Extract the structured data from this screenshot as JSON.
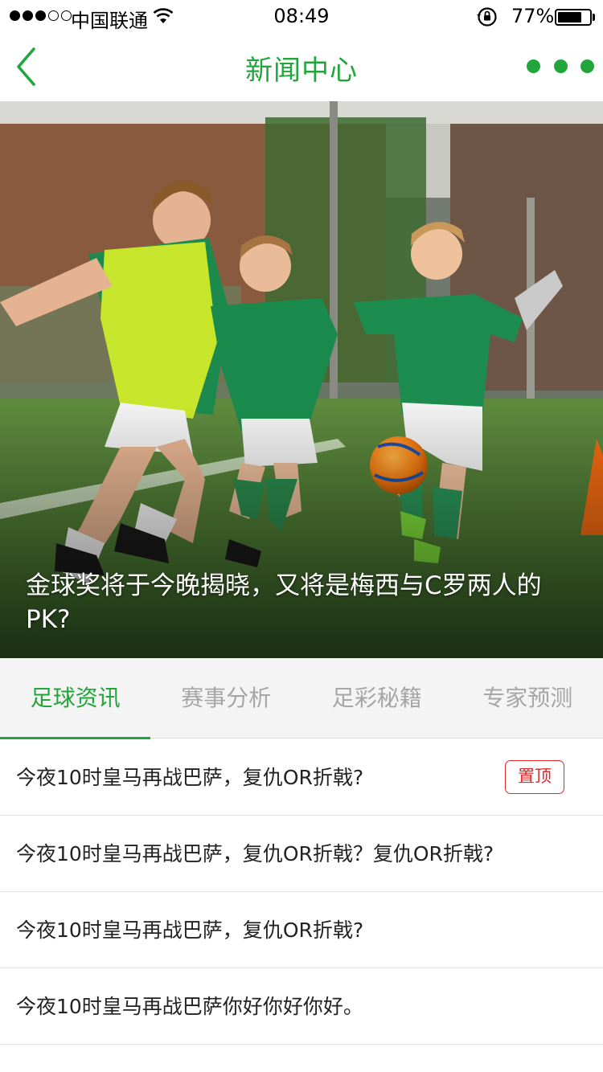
{
  "status_bar": {
    "signal_full": 3,
    "signal_total": 5,
    "carrier": "中国联通",
    "time": "08:49",
    "battery_pct": "77%",
    "battery_level": 0.77
  },
  "nav": {
    "title": "新闻中心",
    "back_icon": "chevron-left-icon",
    "more_icon": "more-dots-icon",
    "accent_color": "#22a53a"
  },
  "hero": {
    "caption": "金球奖将于今晚揭晓，又将是梅西与C罗两人的PK?"
  },
  "tabs": [
    {
      "label": "足球资讯",
      "active": true
    },
    {
      "label": "赛事分析",
      "active": false
    },
    {
      "label": "足彩秘籍",
      "active": false
    },
    {
      "label": "专家预测",
      "active": false
    }
  ],
  "news": [
    {
      "title": "今夜10时皇马再战巴萨，复仇OR折戟?",
      "badge": "置顶"
    },
    {
      "title": "今夜10时皇马再战巴萨，复仇OR折戟？复仇OR折戟?"
    },
    {
      "title": "今夜10时皇马再战巴萨，复仇OR折戟?"
    },
    {
      "title": "今夜10时皇马再战巴萨你好你好你好。"
    }
  ],
  "colors": {
    "badge": "#e02a2a",
    "tab_inactive": "#a6a6a6"
  }
}
